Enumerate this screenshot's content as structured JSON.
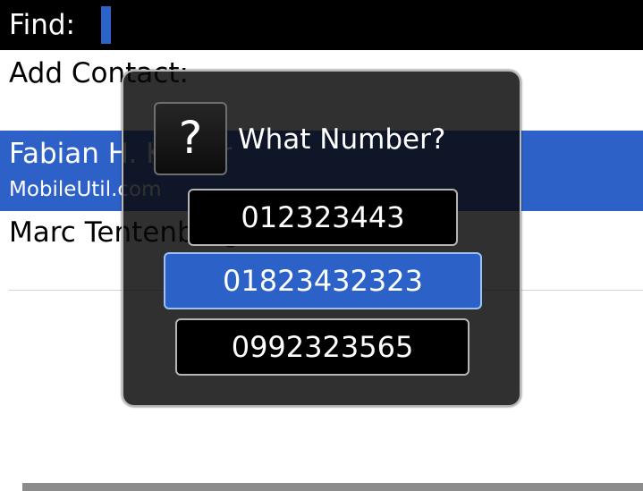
{
  "find": {
    "label": "Find:",
    "value": "",
    "placeholder": ""
  },
  "list": {
    "add_contact": "Add Contact:",
    "contacts": [
      {
        "name": "Fabian H. Kieser",
        "detail": "MobileUtil.com"
      },
      {
        "name": "Marc Tentenberg"
      }
    ]
  },
  "dialog": {
    "icon": "question-icon",
    "icon_glyph": "?",
    "title": "What Number?",
    "options": [
      "012323443",
      "01823432323",
      "0992323565"
    ],
    "selected_index": 1
  },
  "colors": {
    "selection": "#2d61c8",
    "dialog_bg": "#0a0a0a",
    "button_border": "#b5b5b5"
  }
}
